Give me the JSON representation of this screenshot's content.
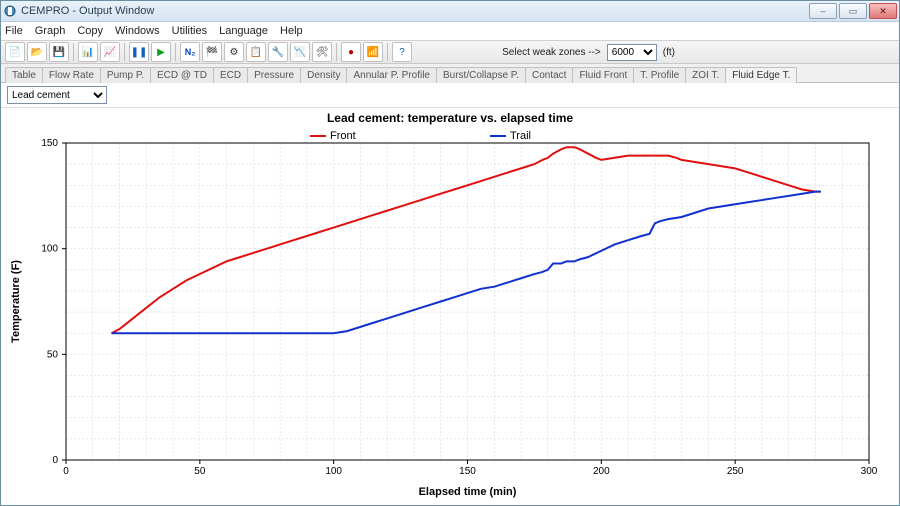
{
  "window": {
    "title": "CEMPRO - Output Window"
  },
  "menu": {
    "items": [
      "File",
      "Graph",
      "Copy",
      "Windows",
      "Utilities",
      "Language",
      "Help"
    ]
  },
  "toolbar": {
    "buttons": [
      "new",
      "open",
      "save",
      "sep",
      "chart-bar",
      "chart-line",
      "sep",
      "pause",
      "play",
      "sep",
      "n2",
      "flag",
      "gear",
      "copy",
      "settings",
      "plot",
      "settings2",
      "sep",
      "circle",
      "wifi",
      "sep",
      "help"
    ],
    "weak_label": "Select weak zones -->",
    "weak_value": "6000",
    "weak_unit": "(ft)"
  },
  "tabs": {
    "items": [
      "Table",
      "Flow Rate",
      "Pump P.",
      "ECD @ TD",
      "ECD",
      "Pressure",
      "Density",
      "Annular P. Profile",
      "Burst/Collapse P.",
      "Contact",
      "Fluid Front",
      "T. Profile",
      "ZOI T.",
      "Fluid Edge T."
    ],
    "active_index": 13
  },
  "selector": {
    "value": "Lead cement"
  },
  "chart_data": {
    "type": "line",
    "title": "Lead cement: temperature vs. elapsed time",
    "xlabel": "Elapsed time (min)",
    "ylabel": "Temperature (F)",
    "xlim": [
      0,
      300
    ],
    "ylim": [
      0,
      150
    ],
    "x_ticks": [
      0,
      50,
      100,
      150,
      200,
      250,
      300
    ],
    "y_ticks": [
      0,
      50,
      100,
      150
    ],
    "series": [
      {
        "name": "Front",
        "color": "#e01010",
        "x": [
          17,
          20,
          25,
          30,
          35,
          40,
          45,
          50,
          55,
          60,
          65,
          70,
          75,
          80,
          85,
          90,
          95,
          100,
          105,
          110,
          115,
          120,
          125,
          130,
          135,
          140,
          145,
          150,
          155,
          160,
          165,
          170,
          175,
          178,
          180,
          182,
          185,
          187,
          190,
          192,
          195,
          198,
          200,
          205,
          210,
          215,
          220,
          225,
          228,
          230,
          235,
          240,
          245,
          250,
          255,
          260,
          265,
          270,
          275,
          280,
          282
        ],
        "y": [
          60,
          62,
          67,
          72,
          77,
          81,
          85,
          88,
          91,
          94,
          96,
          98,
          100,
          102,
          104,
          106,
          108,
          110,
          112,
          114,
          116,
          118,
          120,
          122,
          124,
          126,
          128,
          130,
          132,
          134,
          136,
          138,
          140,
          142,
          143,
          145,
          147,
          148,
          148,
          147,
          145,
          143,
          142,
          143,
          144,
          144,
          144,
          144,
          143,
          142,
          141,
          140,
          139,
          138,
          136,
          134,
          132,
          130,
          128,
          127,
          127
        ]
      },
      {
        "name": "Trail",
        "color": "#1030d0",
        "x": [
          17,
          30,
          50,
          70,
          90,
          95,
          100,
          105,
          110,
          115,
          120,
          125,
          130,
          135,
          140,
          145,
          150,
          155,
          160,
          165,
          170,
          175,
          178,
          180,
          182,
          185,
          187,
          190,
          192,
          195,
          200,
          205,
          210,
          215,
          218,
          220,
          222,
          225,
          230,
          235,
          240,
          245,
          250,
          255,
          260,
          265,
          270,
          275,
          280,
          282
        ],
        "y": [
          60,
          60,
          60,
          60,
          60,
          60,
          60,
          61,
          63,
          65,
          67,
          69,
          71,
          73,
          75,
          77,
          79,
          81,
          82,
          84,
          86,
          88,
          89,
          90,
          93,
          93,
          94,
          94,
          95,
          96,
          99,
          102,
          104,
          106,
          107,
          112,
          113,
          114,
          115,
          117,
          119,
          120,
          121,
          122,
          123,
          124,
          125,
          126,
          127,
          127
        ]
      }
    ]
  }
}
